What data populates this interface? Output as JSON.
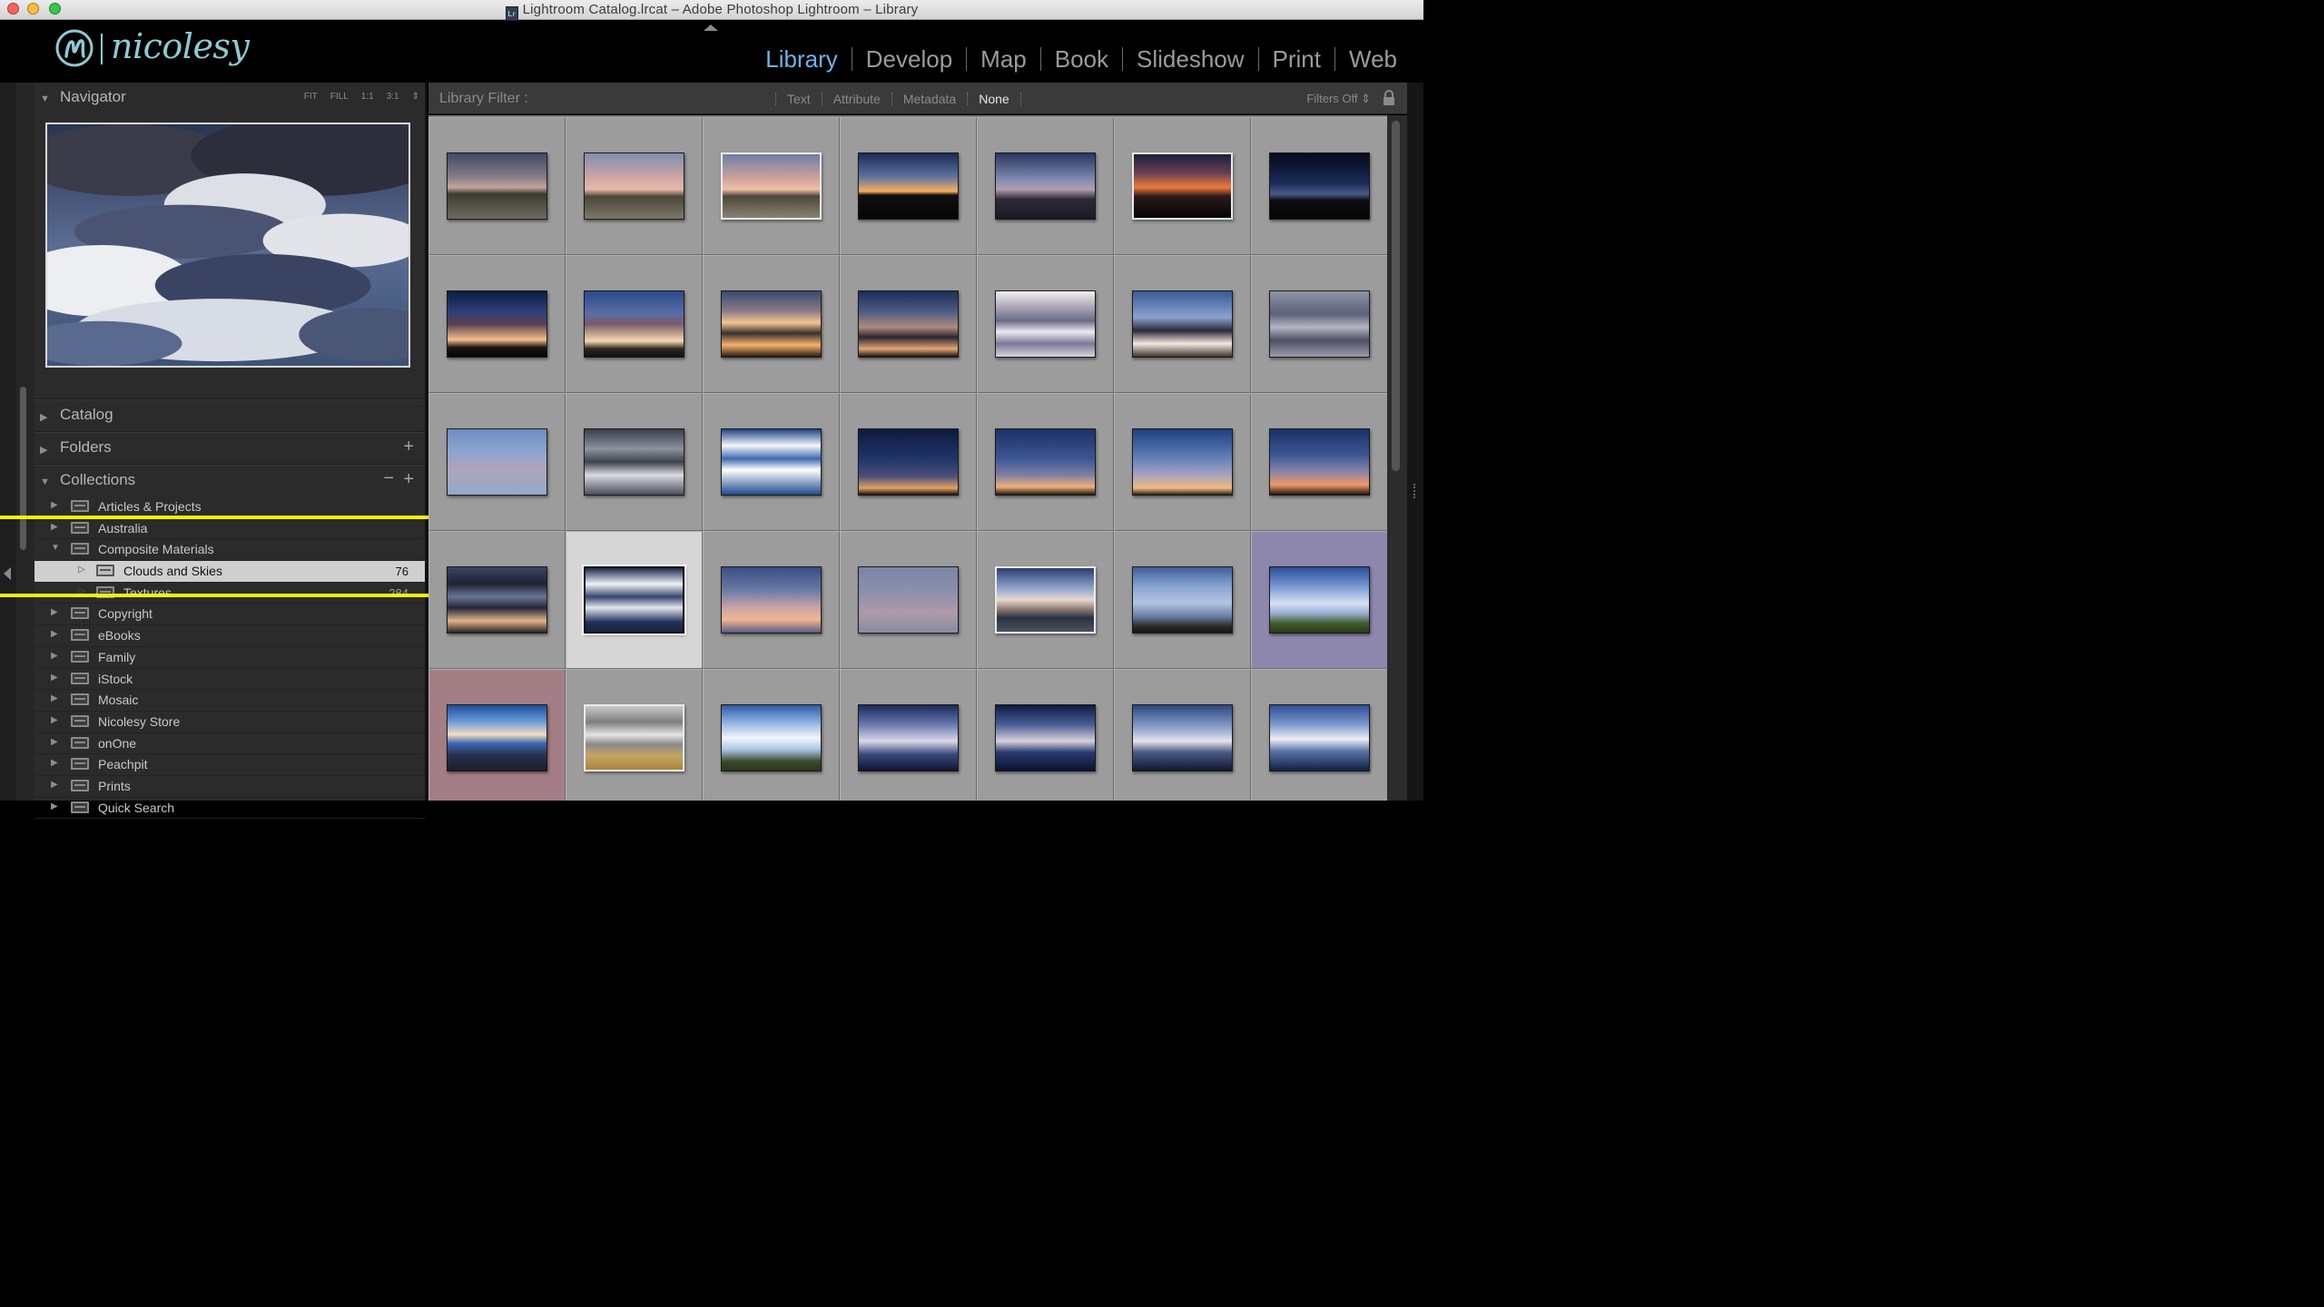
{
  "window": {
    "title": "Lightroom Catalog.lrcat – Adobe Photoshop Lightroom – Library",
    "doc_icon_text": "Lr"
  },
  "identity_plate": {
    "text": "nicolesy",
    "color": "#8ccbd2"
  },
  "modules": [
    {
      "label": "Library",
      "active": true
    },
    {
      "label": "Develop",
      "active": false
    },
    {
      "label": "Map",
      "active": false
    },
    {
      "label": "Book",
      "active": false
    },
    {
      "label": "Slideshow",
      "active": false
    },
    {
      "label": "Print",
      "active": false
    },
    {
      "label": "Web",
      "active": false
    }
  ],
  "navigator": {
    "title": "Navigator",
    "zoom_options": [
      "FIT",
      "FILL",
      "1:1",
      "3:1"
    ]
  },
  "panels": {
    "catalog": "Catalog",
    "folders": "Folders",
    "collections": "Collections"
  },
  "collections": [
    {
      "name": "Articles & Projects"
    },
    {
      "name": "Australia"
    },
    {
      "name": "Composite Materials",
      "expanded": true
    },
    {
      "name": "Clouds and Skies",
      "count": "76",
      "child": true,
      "selected": true
    },
    {
      "name": "Textures",
      "count": "284",
      "child": true
    },
    {
      "name": "Copyright"
    },
    {
      "name": "eBooks"
    },
    {
      "name": "Family"
    },
    {
      "name": "iStock"
    },
    {
      "name": "Mosaic"
    },
    {
      "name": "Nicolesy Store"
    },
    {
      "name": "onOne"
    },
    {
      "name": "Peachpit"
    },
    {
      "name": "Prints"
    },
    {
      "name": "Quick Search"
    }
  ],
  "filter_bar": {
    "label": "Library Filter :",
    "items": [
      {
        "label": "Text",
        "active": false
      },
      {
        "label": "Attribute",
        "active": false
      },
      {
        "label": "Metadata",
        "active": false
      },
      {
        "label": "None",
        "active": true
      }
    ],
    "filters_off": "Filters Off ⇕"
  },
  "grid": {
    "thumbs": [
      {
        "bg": "linear-gradient(#3c4a66 0%, #8a7f89 38%, #c4a89a 52%, #3d3a30 62%, #6e6a5d 100%)",
        "bright": false
      },
      {
        "bg": "linear-gradient(#7f8eb0 0%, #d6a8a4 40%, #e6b8a8 55%, #4b4638 66%, #7d776a 100%)",
        "bright": false
      },
      {
        "bg": "linear-gradient(#6c7fa6 0%, #d6a49c 40%, #f0c0a6 55%, #4b4638 66%, #8a8474 100%)",
        "bright": true
      },
      {
        "bg": "linear-gradient(#1a2b55 0%, #5c6fa0 35%, #f5b062 58%, #101010 64%, #050505 100%)",
        "bright": false
      },
      {
        "bg": "linear-gradient(#2a3660 0%, #7f8bb0 40%, #b49fb0 55%, #2c2a36 70%, #1a1a24 100%)",
        "bright": false
      },
      {
        "bg": "linear-gradient(#1a1f3a 0%, #6a4054 30%, #f07a3a 52%, #2c1a1a 66%, #050505 100%)",
        "bright": true
      },
      {
        "bg": "linear-gradient(#050a1c 0%, #1a2a55 45%, #4a5a8a 62%, #0c0c12 72%, #050505 100%)",
        "bright": false
      },
      {
        "bg": "linear-gradient(#0d1c44 0%, #2c3f78 30%, #5a3f52 50%, #f2c08a 74%, #1a1410 86%, #050505 100%)",
        "bright": false
      },
      {
        "bg": "linear-gradient(#2a4a8a 0%, #5a6ea6 35%, #7a5a6a 50%, #f5d8b0 76%, #2a2620 88%, #111 100%)",
        "bright": false
      },
      {
        "bg": "linear-gradient(#3a4a6e 0%, #8a7a86 30%, #f4c690 48%, #3a3030 64%, #f7b26a 82%, #2a1c14 100%)",
        "bright": false
      },
      {
        "bg": "linear-gradient(#1c2e58 0%, #4a5a86 30%, #b08a7e 55%, #2a2630 70%, #e4a476 88%, #1a1410 100%)",
        "bright": false
      },
      {
        "bg": "linear-gradient(#f4f0ee 0%, #a8a4b4 25%, #6a6a86 45%, #eeeaf0 62%, #7a7896 80%, #d8d4dc 100%)",
        "bright": false
      },
      {
        "bg": "linear-gradient(#3a5a96 0%, #8aa2ce 40%, #2a2a3a 60%, #f4e8e0 80%, #3a3430 100%)",
        "bright": false
      },
      {
        "bg": "linear-gradient(#8e92a6 0%, #5e627a 35%, #b4b4c2 55%, #4e4e62 75%, #9c9cae 100%)",
        "bright": false
      },
      {
        "bg": "linear-gradient(#6e8cc0 0%, #8ca6d0 35%, #b0a4ba 60%, #94a8cc 100%)",
        "bright": false
      },
      {
        "bg": "linear-gradient(#3a3e4a 0%, #8e929e 30%, #3e424c 50%, #dadbe0 70%, #4a4e5a 100%)",
        "bright": false
      },
      {
        "bg": "linear-gradient(#1e4488 0%, #f4f6fa 25%, #3e6ab0 45%, #ffffff 62%, #1e4a8e 100%)",
        "bright": false
      },
      {
        "bg": "linear-gradient(#0e1a3c 0%, #203468 45%, #4a4e7a 72%, #e2a066 90%, #1a1410 100%)",
        "bright": false
      },
      {
        "bg": "linear-gradient(#1c3266 0%, #3c5694 45%, #7e7ea4 70%, #f0b078 88%, #22180e 100%)",
        "bright": false
      },
      {
        "bg": "linear-gradient(#20407e 0%, #5a7ab4 40%, #a6a4c0 70%, #f0b880 90%, #2a2218 100%)",
        "bright": false
      },
      {
        "bg": "linear-gradient(#1a3066 0%, #3e5896 40%, #8a84a8 65%, #f0986a 85%, #1e140e 100%)",
        "bright": false
      },
      {
        "bg": "linear-gradient(#3a4466 0%, #1e2230 25%, #6a7496 45%, #242636 62%, #e0b48e 82%, #2a2420 100%)",
        "bright": false
      },
      {
        "bg": "linear-gradient(#1e2a4a 0%, #f0f2f6 25%, #36466e 45%, #e2e6ee 62%, #203058 85%, #1a2440 100%)",
        "bright": false
      },
      {
        "bg": "linear-gradient(#3a4e82 0%, #6a7aa6 35%, #c6a0a6 60%, #f0b890 80%, #5a5a80 100%)",
        "bright": false
      },
      {
        "bg": "linear-gradient(#7a84a6 0%, #8e90ac 40%, #b09aa8 70%, #8a8aa4 100%)",
        "bright": false
      },
      {
        "bg": "linear-gradient(#2a3e6e 0%, #8aa0c8 30%, #e6d8d0 50%, #a08a82 62%, #2a3240 78%, #4a5260 100%)",
        "bright": true
      },
      {
        "bg": "linear-gradient(#3e5e9a 0%, #8aa6d2 30%, #b2c4e0 55%, #6a7ea8 75%, #2a2e26 90%, #141612 100%)",
        "bright": false
      },
      {
        "bg": "linear-gradient(#2a4e9a 0%, #7a9ad2 30%, #d6e0f2 55%, #9cb0d8 70%, #3e5a2a 86%, #2a3a1a 100%)",
        "bright": false
      },
      {
        "bg": "linear-gradient(#1e4e9e 0%, #6a9ad8 25%, #f2dcc0 45%, #3e6ab4 58%, #2a3050 76%, #1a1e28 100%)",
        "bright": false
      },
      {
        "bg": "linear-gradient(#c8c8c8 0%, #7e7e7e 25%, #e4e4e4 45%, #8a8a8a 60%, #c8a464 78%, #a88440 100%)",
        "bright": true
      },
      {
        "bg": "linear-gradient(#2e5aa6 0%, #8aaee0 25%, #f2f6fa 50%, #aac4e6 68%, #3a4a2a 86%, #2a3420 100%)",
        "bright": false
      },
      {
        "bg": "linear-gradient(#1a2a5a 0%, #6a7ab0 30%, #dcd8e8 55%, #3a4a80 75%, #0e1430 100%)",
        "bright": false
      },
      {
        "bg": "linear-gradient(#0e1a44 0%, #4a5e96 30%, #d8d0dc 55%, #2a3a70 72%, #0a1230 100%)",
        "bright": false
      },
      {
        "bg": "linear-gradient(#2a4682 0%, #8ea2cc 35%, #e6e2ea 55%, #4a5a86 72%, #10182e 100%)",
        "bright": false
      },
      {
        "bg": "linear-gradient(#2e4e96 0%, #7e9ace 30%, #f0eef4 52%, #5a74a8 70%, #122040 100%)",
        "bright": false
      }
    ]
  }
}
